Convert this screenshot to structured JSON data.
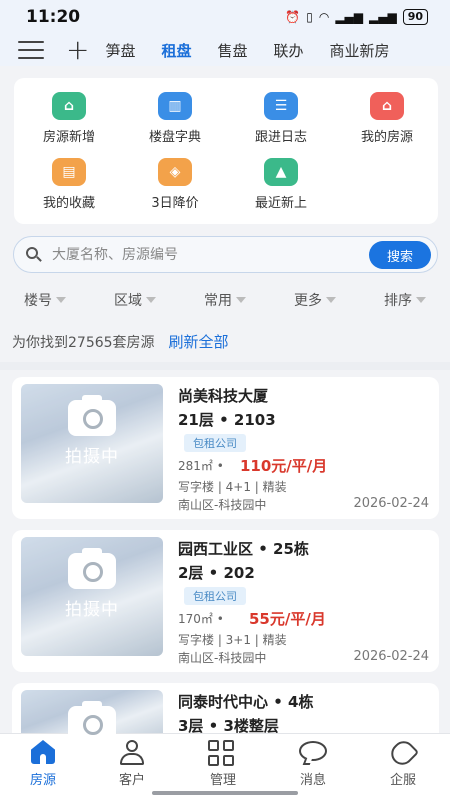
{
  "status_bar": {
    "time": "11:20",
    "battery": "90"
  },
  "top_tabs": [
    "笋盘",
    "租盘",
    "售盘",
    "联办",
    "商业新房"
  ],
  "active_tab_index": 1,
  "quick_actions": [
    {
      "label": "房源新增",
      "icon": "house-plus-icon",
      "color": "#3bb98a"
    },
    {
      "label": "楼盘字典",
      "icon": "building-icon",
      "color": "#3a8ee6"
    },
    {
      "label": "跟进日志",
      "icon": "log-icon",
      "color": "#3a8ee6"
    },
    {
      "label": "我的房源",
      "icon": "my-house-icon",
      "color": "#f0605a"
    },
    {
      "label": "我的收藏",
      "icon": "wallet-icon",
      "color": "#f3a24a"
    },
    {
      "label": "3日降价",
      "icon": "price-tag-icon",
      "color": "#f3a24a"
    },
    {
      "label": "最近新上",
      "icon": "new-bag-icon",
      "color": "#3bb98a"
    }
  ],
  "search": {
    "placeholder": "大厦名称、房源编号",
    "button_label": "搜索"
  },
  "filters": [
    "楼号",
    "区域",
    "常用",
    "更多",
    "排序"
  ],
  "result_text": "为你找到27565套房源",
  "refresh_label": "刷新全部",
  "listings": [
    {
      "title": "尚美科技大厦",
      "floor": "21层 • 2103",
      "badge": "包租公司",
      "area": "281㎡ •",
      "price": "110元/平/月",
      "tags": "写字楼 | 4+1 | 精装",
      "district": "南山区-科技园中",
      "date": "2026-02-24",
      "photo_status": "拍摄中"
    },
    {
      "title": "园西工业区 • 25栋",
      "floor": "2层 • 202",
      "badge": "包租公司",
      "area": "170㎡ •",
      "price": "55元/平/月",
      "tags": "写字楼 | 3+1 | 精装",
      "district": "南山区-科技园中",
      "date": "2026-02-24",
      "photo_status": "拍摄中"
    },
    {
      "title": "同泰时代中心 • 4栋",
      "floor": "3层 • 3楼整层",
      "photo_status": ""
    }
  ],
  "bottom_nav": [
    {
      "label": "房源",
      "icon": "home-icon"
    },
    {
      "label": "客户",
      "icon": "person-icon"
    },
    {
      "label": "管理",
      "icon": "grid-icon"
    },
    {
      "label": "消息",
      "icon": "message-icon"
    },
    {
      "label": "企服",
      "icon": "heart-icon"
    }
  ],
  "colors": {
    "accent": "#1b6fd9",
    "price": "#d9382c"
  }
}
